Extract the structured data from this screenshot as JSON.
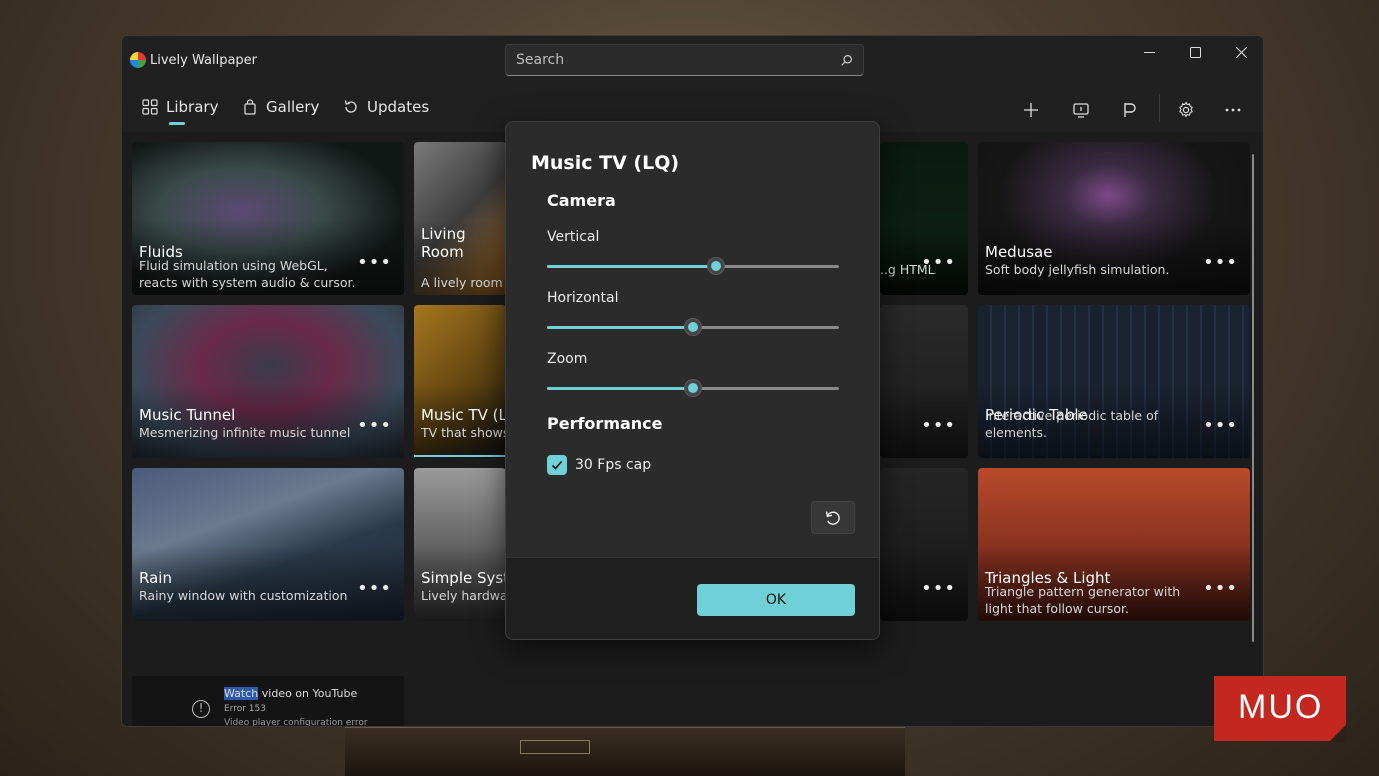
{
  "app": {
    "title": "Lively Wallpaper"
  },
  "search": {
    "placeholder": "Search"
  },
  "window_controls": {
    "minimize": "—",
    "maximize": "☐",
    "close": "✕"
  },
  "nav": {
    "tabs": [
      {
        "label": "Library",
        "icon": "grid-icon",
        "selected": true
      },
      {
        "label": "Gallery",
        "icon": "shopping-bag-icon"
      },
      {
        "label": "Updates",
        "icon": "refresh-icon"
      }
    ],
    "toolbar": [
      "add-icon",
      "screen-layout-icon",
      "flag-icon",
      "gear-icon",
      "more-icon"
    ]
  },
  "library": {
    "tiles": [
      {
        "title": "Fluids",
        "desc": "Fluid simulation using WebGL, reacts with system audio & cursor.",
        "more": "•••"
      },
      {
        "title": "Living Room",
        "desc": "A lively room w... more!",
        "more": "•••"
      },
      {
        "title": "",
        "desc": "...g HTML5",
        "more": "•••"
      },
      {
        "title": "Medusae",
        "desc": "Soft body jellyfish simulation.",
        "more": "•••"
      },
      {
        "title": "Music Tunnel",
        "desc": "Mesmerizing infinite music tunnel",
        "more": "•••"
      },
      {
        "title": "Music TV (LQ)",
        "desc": "TV that shows c...",
        "more": "•••"
      },
      {
        "title": "",
        "desc": "",
        "more": "•••"
      },
      {
        "title": "Periodic Table",
        "desc": "Interactive periodic table of elements.",
        "more": "•••"
      },
      {
        "title": "Rain",
        "desc": "Rainy window with customization",
        "more": "•••"
      },
      {
        "title": "Simple Syster",
        "desc": "Lively hardware",
        "more": "•••"
      },
      {
        "title": "",
        "desc": "",
        "more": "•••"
      },
      {
        "title": "Triangles & Light",
        "desc": "Triangle pattern generator with light that follow cursor.",
        "more": "•••"
      }
    ],
    "youtube_tile": {
      "link_hl": "Watch",
      "link_rest": " video on YouTube",
      "error": "Error 153",
      "sub": "Video player configuration error"
    }
  },
  "dialog": {
    "title": "Music TV (LQ)",
    "camera_section": "Camera",
    "sliders": [
      {
        "label": "Vertical",
        "value": 0.58
      },
      {
        "label": "Horizontal",
        "value": 0.5
      },
      {
        "label": "Zoom",
        "value": 0.5
      }
    ],
    "performance_section": "Performance",
    "fps_checkbox": {
      "label": "30 Fps cap",
      "checked": true
    },
    "ok_label": "OK"
  },
  "watermark": {
    "text": "MUO"
  },
  "colors": {
    "accent": "#6fd1d7",
    "window_bg": "#202020",
    "dialog_bg": "#2b2b2b"
  }
}
